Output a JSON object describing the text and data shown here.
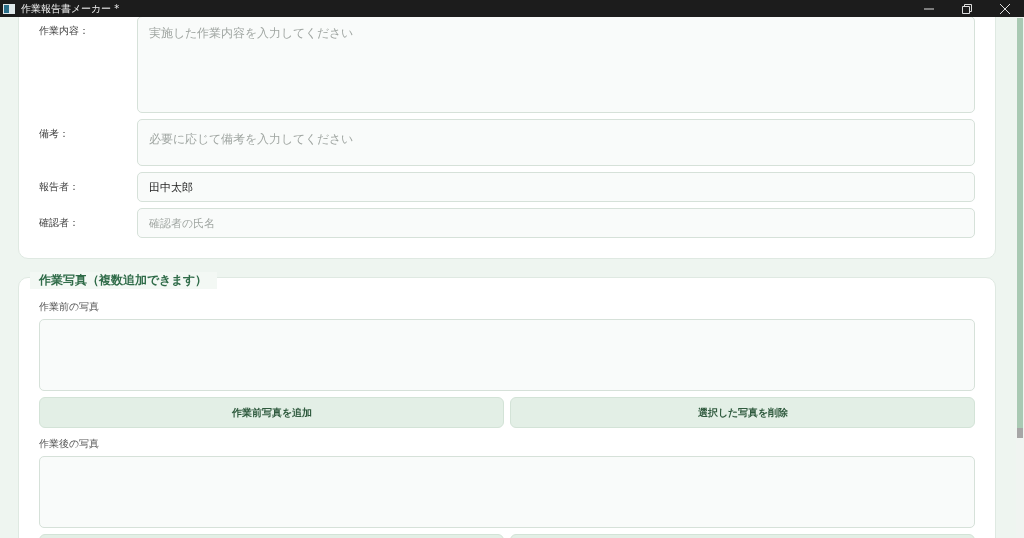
{
  "window": {
    "title": "作業報告書メーカー *"
  },
  "form_fields": [
    {
      "label": "作業内容：",
      "kind": "textarea",
      "placeholder": "実施した作業内容を入力してください"
    },
    {
      "label": "備考：",
      "kind": "memo",
      "placeholder": "必要に応じて備考を入力してください"
    },
    {
      "label": "報告者：",
      "kind": "line",
      "value": "田中太郎"
    },
    {
      "label": "確認者：",
      "kind": "line",
      "placeholder": "確認者の氏名"
    }
  ],
  "photos_group": {
    "title": "作業写真（複数追加できます）",
    "sections": [
      {
        "label": "作業前の写真",
        "buttons": [
          "作業前写真を追加",
          "選択した写真を削除"
        ]
      },
      {
        "label": "作業後の写真"
      }
    ]
  }
}
